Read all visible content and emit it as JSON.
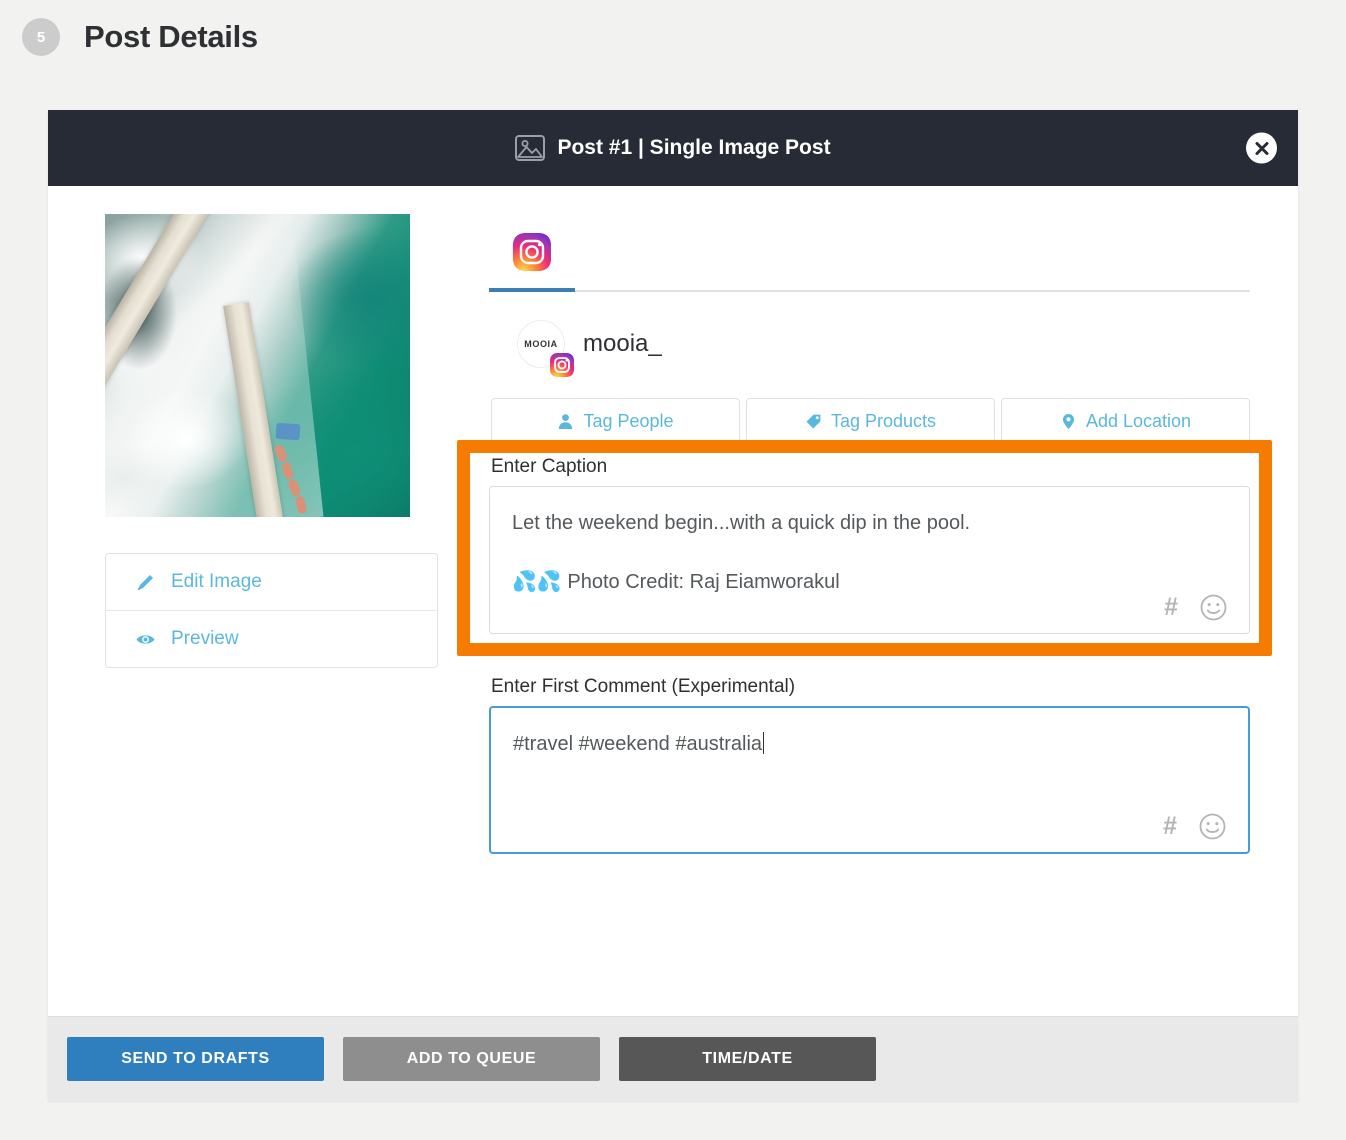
{
  "page": {
    "step_number": "5",
    "title": "Post Details"
  },
  "modal": {
    "header_title": "Post #1 | Single Image Post",
    "header_icon": "image-placeholder-icon",
    "close_icon": "close-icon"
  },
  "left_panel": {
    "photo_alt": "aerial-ocean-pool-photo",
    "actions": [
      {
        "label": "Edit Image",
        "icon": "pencil-icon"
      },
      {
        "label": "Preview",
        "icon": "eye-icon"
      }
    ]
  },
  "right_panel": {
    "tabs": [
      {
        "label": "Instagram",
        "icon": "instagram-icon",
        "active": true
      }
    ],
    "account": {
      "avatar_text": "MOOIA",
      "username": "mooia_",
      "badge_icon": "instagram-icon"
    },
    "tag_buttons": [
      {
        "label": "Tag People",
        "icon": "person-icon"
      },
      {
        "label": "Tag Products",
        "icon": "tag-icon"
      },
      {
        "label": "Add Location",
        "icon": "location-pin-icon"
      }
    ],
    "caption": {
      "label": "Enter Caption",
      "line1": "Let the weekend begin...with a quick dip in the pool.",
      "emoji": "💦💦",
      "line2": "Photo Credit: Raj Eiamworakul",
      "hash_icon": "hashtag-icon",
      "emoji_icon": "smiley-icon",
      "highlighted": true,
      "highlight_color": "#f57c00"
    },
    "first_comment": {
      "label": "Enter First Comment (Experimental)",
      "value": "#travel #weekend #australia",
      "hash_icon": "hashtag-icon",
      "emoji_icon": "smiley-icon",
      "focused": true,
      "focus_color": "#4a9bd4"
    }
  },
  "footer": {
    "buttons": [
      {
        "label": "SEND TO DRAFTS",
        "color": "#2f7fbf"
      },
      {
        "label": "ADD TO QUEUE",
        "color": "#8e8e8e"
      },
      {
        "label": "TIME/DATE",
        "color": "#575757"
      }
    ]
  }
}
